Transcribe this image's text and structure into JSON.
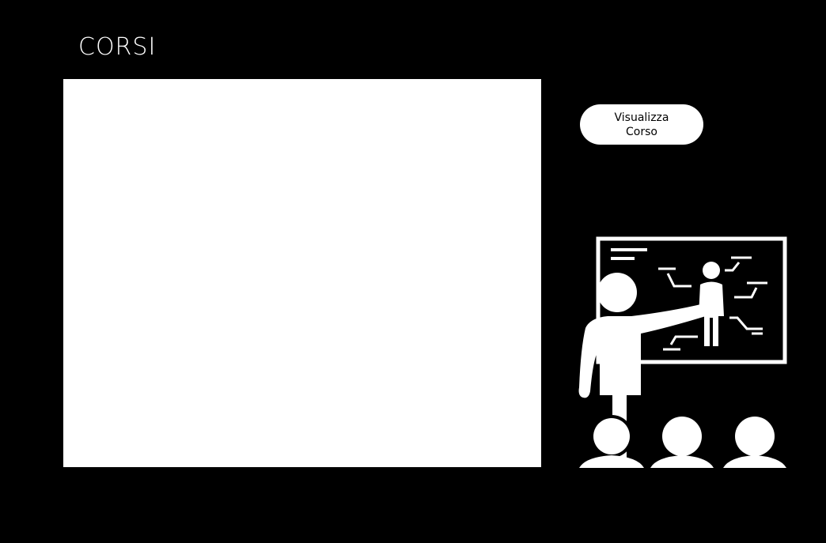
{
  "page": {
    "title": "CORSI"
  },
  "actions": {
    "view_course_label": "Visualizza Corso"
  },
  "illustration": {
    "icon": "teacher-classroom-icon",
    "color": "#ffffff",
    "background": "#000000"
  },
  "colors": {
    "background": "#000000",
    "panel": "#ffffff",
    "button_bg": "#ffffff",
    "button_text": "#000000"
  }
}
